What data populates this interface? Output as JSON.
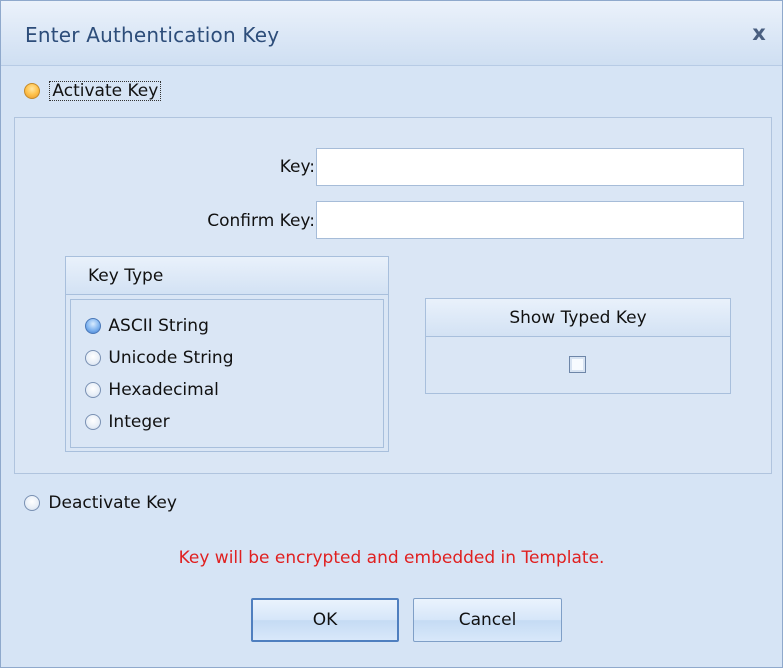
{
  "window": {
    "title": "Enter Authentication Key",
    "close_label": "x"
  },
  "activate": {
    "label": "Activate Key",
    "selected": true
  },
  "fields": {
    "key_label": "Key:",
    "key_value": "",
    "confirm_label": "Confirm Key:",
    "confirm_value": ""
  },
  "key_type": {
    "header": "Key Type",
    "options": [
      {
        "label": "ASCII String",
        "selected": true
      },
      {
        "label": "Unicode String",
        "selected": false
      },
      {
        "label": "Hexadecimal",
        "selected": false
      },
      {
        "label": "Integer",
        "selected": false
      }
    ]
  },
  "show_typed": {
    "header": "Show Typed Key",
    "checked": false
  },
  "deactivate": {
    "label": "Deactivate Key",
    "selected": false
  },
  "note": "Key will be encrypted and embedded in Template.",
  "buttons": {
    "ok": "OK",
    "cancel": "Cancel"
  },
  "colors": {
    "note": "#e02020",
    "title": "#2d4d7a",
    "background": "#d6e4f5"
  }
}
